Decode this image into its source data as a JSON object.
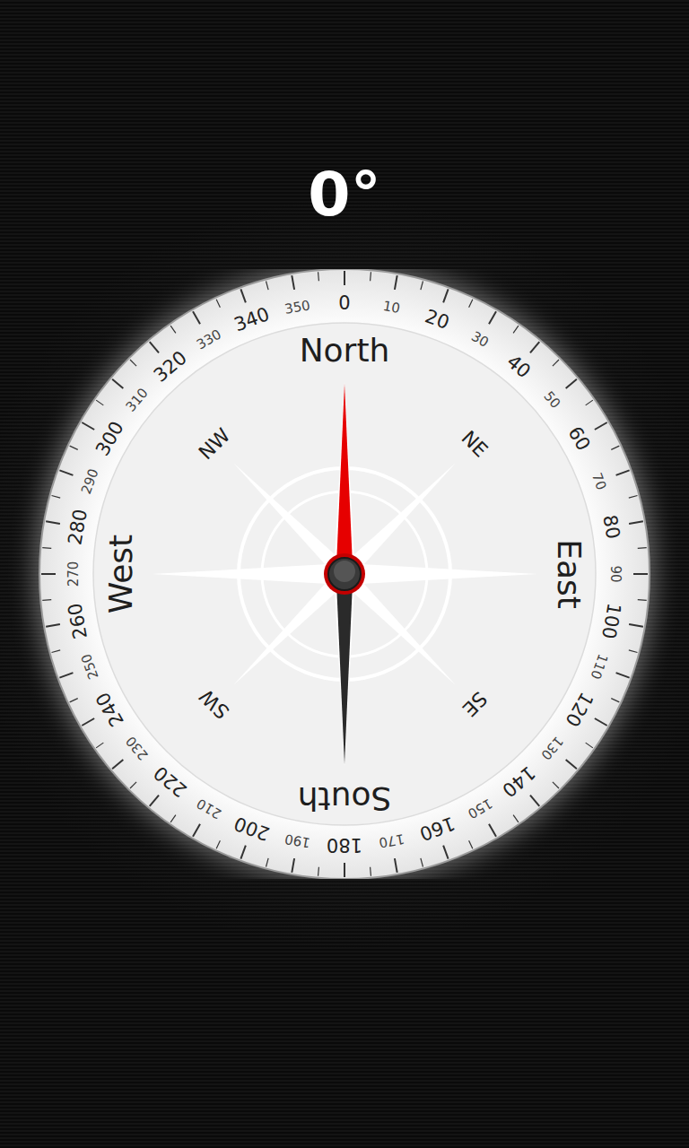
{
  "heading": "0°",
  "needle_angle": 0,
  "cardinals": [
    "North",
    "East",
    "South",
    "West"
  ],
  "intercardinals": [
    "NE",
    "SE",
    "SW",
    "NW"
  ],
  "dial": [
    "0",
    "10",
    "20",
    "30",
    "40",
    "50",
    "60",
    "70",
    "80",
    "90",
    "100",
    "110",
    "120",
    "130",
    "140",
    "150",
    "160",
    "170",
    "180",
    "190",
    "200",
    "210",
    "220",
    "230",
    "240",
    "250",
    "260",
    "270",
    "280",
    "290",
    "300",
    "310",
    "320",
    "330",
    "340",
    "350"
  ]
}
